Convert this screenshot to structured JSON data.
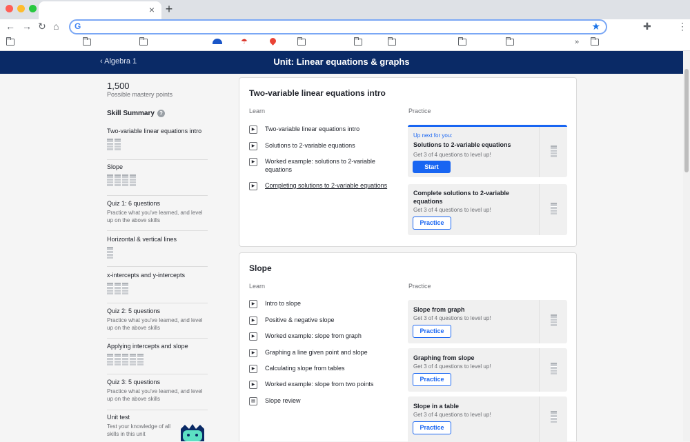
{
  "browser": {
    "tab_close": "×",
    "new_tab": "+",
    "bookmark_overflow": "»"
  },
  "header": {
    "breadcrumb": "‹ Algebra 1",
    "unit_title": "Unit: Linear equations & graphs"
  },
  "sidebar": {
    "mastery_points": "1,500",
    "mastery_label": "Possible mastery points",
    "skill_summary_title": "Skill Summary",
    "items": [
      {
        "name": "Two-variable linear equations intro",
        "desc": ""
      },
      {
        "name": "Slope",
        "desc": ""
      },
      {
        "name": "Quiz 1: 6 questions",
        "desc": "Practice what you've learned, and level up on the above skills"
      },
      {
        "name": "Horizontal & vertical lines",
        "desc": ""
      },
      {
        "name": "x-intercepts and y-intercepts",
        "desc": ""
      },
      {
        "name": "Quiz 2: 5 questions",
        "desc": "Practice what you've learned, and level up on the above skills"
      },
      {
        "name": "Applying intercepts and slope",
        "desc": ""
      },
      {
        "name": "Quiz 3: 5 questions",
        "desc": "Practice what you've learned, and level up on the above skills"
      },
      {
        "name": "Unit test",
        "desc": "Test your knowledge of all skills in this unit"
      }
    ]
  },
  "cards": [
    {
      "title": "Two-variable linear equations intro",
      "learn_label": "Learn",
      "practice_label": "Practice",
      "learn_items": [
        "Two-variable linear equations intro",
        "Solutions to 2-variable equations",
        "Worked example: solutions to 2-variable equations",
        "Completing solutions to 2-variable equations"
      ],
      "practice": [
        {
          "up_next": "Up next for you:",
          "name": "Solutions to 2-variable equations",
          "sub": "Get 3 of 4 questions to level up!",
          "button": "Start"
        },
        {
          "name": "Complete solutions to 2-variable equations",
          "sub": "Get 3 of 4 questions to level up!",
          "button": "Practice"
        }
      ]
    },
    {
      "title": "Slope",
      "learn_label": "Learn",
      "practice_label": "Practice",
      "learn_items": [
        "Intro to slope",
        "Positive & negative slope",
        "Worked example: slope from graph",
        "Graphing a line given point and slope",
        "Calculating slope from tables",
        "Worked example: slope from two points",
        "Slope review"
      ],
      "practice": [
        {
          "name": "Slope from graph",
          "sub": "Get 3 of 4 questions to level up!",
          "button": "Practice"
        },
        {
          "name": "Graphing from slope",
          "sub": "Get 3 of 4 questions to level up!",
          "button": "Practice"
        },
        {
          "name": "Slope in a table",
          "sub": "Get 3 of 4 questions to level up!",
          "button": "Practice"
        }
      ]
    }
  ]
}
